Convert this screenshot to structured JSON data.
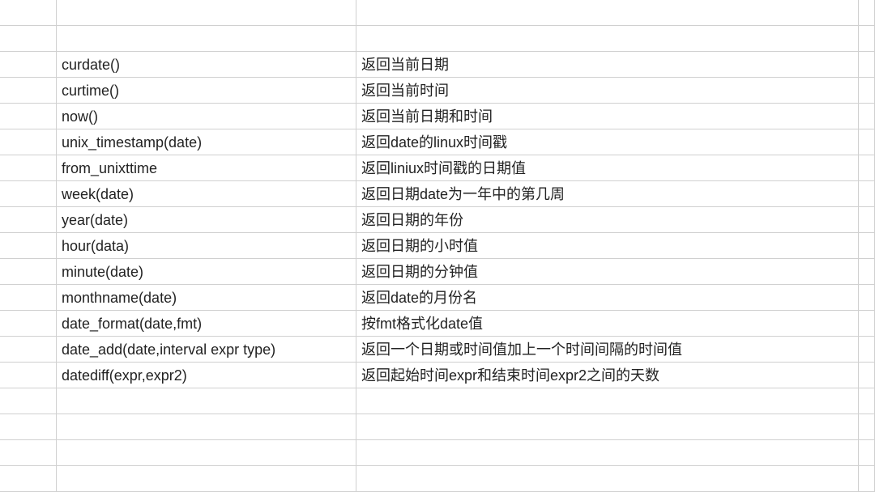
{
  "rows": [
    {
      "func": "",
      "desc": ""
    },
    {
      "func": "",
      "desc": ""
    },
    {
      "func": "curdate()",
      "desc": "返回当前日期"
    },
    {
      "func": "curtime()",
      "desc": "返回当前时间"
    },
    {
      "func": "now()",
      "desc": "返回当前日期和时间"
    },
    {
      "func": "unix_timestamp(date)",
      "desc": "返回date的linux时间戳"
    },
    {
      "func": "from_unixttime",
      "desc": "返回liniux时间戳的日期值"
    },
    {
      "func": "week(date)",
      "desc": "返回日期date为一年中的第几周"
    },
    {
      "func": "year(date)",
      "desc": "返回日期的年份"
    },
    {
      "func": "hour(data)",
      "desc": "返回日期的小时值"
    },
    {
      "func": "minute(date)",
      "desc": "返回日期的分钟值"
    },
    {
      "func": "monthname(date)",
      "desc": "返回date的月份名"
    },
    {
      "func": "date_format(date,fmt)",
      "desc": "按fmt格式化date值"
    },
    {
      "func": "date_add(date,interval expr type)",
      "desc": "返回一个日期或时间值加上一个时间间隔的时间值"
    },
    {
      "func": "datediff(expr,expr2)",
      "desc": "返回起始时间expr和结束时间expr2之间的天数"
    },
    {
      "func": "",
      "desc": ""
    },
    {
      "func": "",
      "desc": ""
    },
    {
      "func": "",
      "desc": ""
    },
    {
      "func": "",
      "desc": ""
    }
  ]
}
